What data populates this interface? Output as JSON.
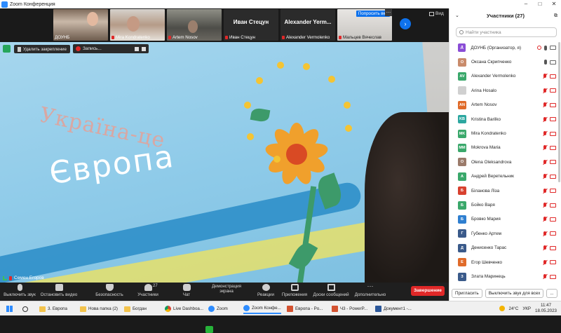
{
  "window": {
    "title": "Zoom Конференция"
  },
  "gallery": {
    "tiles": [
      {
        "name": "ДОУНБ",
        "muted": false
      },
      {
        "name": "Mira Kondratenko",
        "muted": true
      },
      {
        "name": "Artem Nosov",
        "muted": true
      },
      {
        "name": "Иван Стецун",
        "big": "Иван Стецун",
        "muted": true
      },
      {
        "name": "Alexander Vermolenko",
        "big": "Alexander  Yerm...",
        "muted": true
      },
      {
        "name": "Мальцев Вячеслав",
        "muted": true
      }
    ],
    "ask_all": "Попросить вкл",
    "view": "Вид"
  },
  "share": {
    "unpin": "Удалить закрепление",
    "recording": "Запись...",
    "speaker": "Семен Егоров",
    "poster_line1": "Україна-це",
    "poster_line2": "Європа"
  },
  "toolbar": {
    "mute": "Выключить звук",
    "video": "Остановить видео",
    "security": "Безопасность",
    "participants": "Участники",
    "participants_count": "27",
    "chat": "Чат",
    "share": "Демонстрация экрана",
    "reactions": "Реакции",
    "apps": "Приложения",
    "whiteboards": "Доски сообщений",
    "more": "Дополнительно",
    "end": "Завершение"
  },
  "panel": {
    "title": "Участники (27)",
    "search_placeholder": "Найти участника",
    "participants": [
      {
        "initials": "Д",
        "name": "ДОУНБ (Организатор, я)",
        "color": "#8a4dd6",
        "mic": "on",
        "cam": "on",
        "rec": true
      },
      {
        "initials": "О",
        "name": "Оксана Скрипченко",
        "color": "#c98b6b",
        "mic": "on",
        "cam": "on",
        "rec": false
      },
      {
        "initials": "AV",
        "name": "Alexander Vermolenko",
        "color": "#3aa86b",
        "mic": "off",
        "cam": "off",
        "rec": false
      },
      {
        "initials": "",
        "name": "Arina Hosalo",
        "color": "#d0d0d0",
        "mic": "off",
        "cam": "off",
        "rec": false
      },
      {
        "initials": "AN",
        "name": "Artem Nosov",
        "color": "#e06b2a",
        "mic": "off",
        "cam": "off",
        "rec": false
      },
      {
        "initials": "KB",
        "name": "Kristina Barilko",
        "color": "#2ca7a0",
        "mic": "off",
        "cam": "off",
        "rec": false
      },
      {
        "initials": "MK",
        "name": "Mira Kondratenko",
        "color": "#3aa86b",
        "mic": "off",
        "cam": "off",
        "rec": false
      },
      {
        "initials": "MM",
        "name": "Mokrova Maria",
        "color": "#3aa86b",
        "mic": "off",
        "cam": "off",
        "rec": false
      },
      {
        "initials": "O",
        "name": "Olena Oleksandrova",
        "color": "#9b7b6b",
        "mic": "off",
        "cam": "off",
        "rec": false
      },
      {
        "initials": "А",
        "name": "Андрей Веретельник",
        "color": "#3aa86b",
        "mic": "off",
        "cam": "off",
        "rec": false
      },
      {
        "initials": "Б",
        "name": "Біланова Ліза",
        "color": "#d8412f",
        "mic": "off",
        "cam": "off",
        "rec": false
      },
      {
        "initials": "Б",
        "name": "Бойко Варя",
        "color": "#3aa86b",
        "mic": "off",
        "cam": "off",
        "rec": false
      },
      {
        "initials": "Б",
        "name": "Бровко Мария",
        "color": "#2f7fd0",
        "mic": "off",
        "cam": "off",
        "rec": false
      },
      {
        "initials": "Г",
        "name": "Губенко Артем",
        "color": "#3a5a8a",
        "mic": "off",
        "cam": "off",
        "rec": false
      },
      {
        "initials": "Д",
        "name": "Денисенко Тарас",
        "color": "#3a5a8a",
        "mic": "off",
        "cam": "off",
        "rec": false
      },
      {
        "initials": "Е",
        "name": "Егор Шевченко",
        "color": "#e06b2a",
        "mic": "off",
        "cam": "off",
        "rec": false
      },
      {
        "initials": "З",
        "name": "Злата Маринець",
        "color": "#3a5a8a",
        "mic": "off",
        "cam": "off",
        "rec": false
      }
    ],
    "invite": "Пригласить",
    "mute_all": "Выключить звук для всех",
    "more": "..."
  },
  "taskbar": {
    "items": [
      {
        "label": "3. Европа",
        "icon": "folder-icon"
      },
      {
        "label": "Нова папка (2)",
        "icon": "folder-icon"
      },
      {
        "label": "Богдан",
        "icon": "folder-icon"
      },
      {
        "label": "Live Dashboa...",
        "icon": "chrome-icon"
      },
      {
        "label": "Zoom",
        "icon": "zoom-icon"
      },
      {
        "label": "Zoom Конфе...",
        "icon": "zoom-icon"
      },
      {
        "label": "Европа - Po...",
        "icon": "powerpoint-icon"
      },
      {
        "label": "Ч3 - PowerP...",
        "icon": "powerpoint-icon"
      },
      {
        "label": "Документ1 -...",
        "icon": "word-icon"
      }
    ],
    "temp": "24°C",
    "lang": "УКР",
    "time": "11:47",
    "date": "18.05.2023"
  }
}
